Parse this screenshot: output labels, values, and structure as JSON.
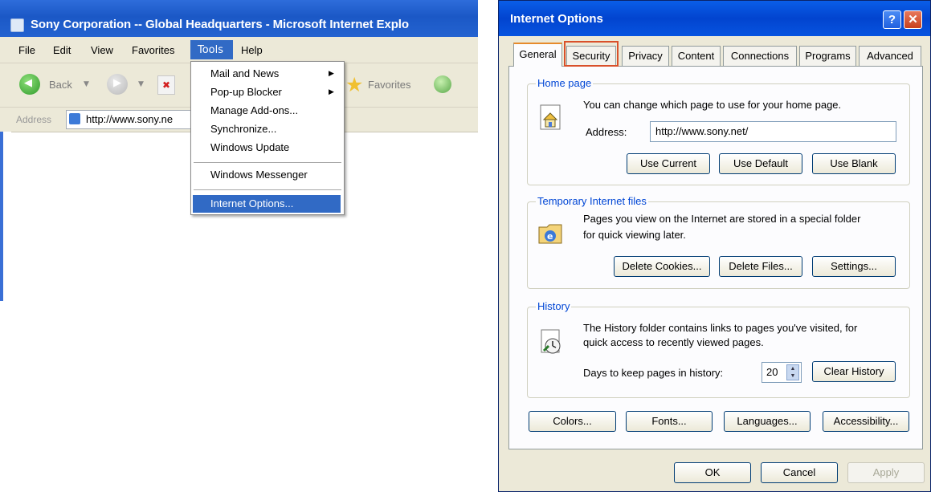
{
  "ie": {
    "title": "Sony Corporation -- Global Headquarters - Microsoft Internet Explo",
    "menu": [
      "File",
      "Edit",
      "View",
      "Favorites",
      "Tools",
      "Help"
    ],
    "toolbar": {
      "back": "Back",
      "favorites": "Favorites"
    },
    "address": {
      "label": "Address",
      "value": "http://www.sony.ne"
    },
    "tools_menu": {
      "items": [
        "Mail and News",
        "Pop-up Blocker",
        "Manage Add-ons...",
        "Synchronize...",
        "Windows Update",
        "Windows Messenger",
        "Internet Options..."
      ]
    }
  },
  "dialog": {
    "title": "Internet Options",
    "help_label": "?",
    "close_label": "✕",
    "tabs": [
      "General",
      "Security",
      "Privacy",
      "Content",
      "Connections",
      "Programs",
      "Advanced"
    ],
    "home_page": {
      "label": "Home page",
      "description": "You can change which page to use for your home page.",
      "address_label": "Address:",
      "address_value": "http://www.sony.net/",
      "buttons": [
        "Use Current",
        "Use Default",
        "Use Blank"
      ]
    },
    "temp_files": {
      "label": "Temporary Internet files",
      "description_1": "Pages you view on the Internet are stored in a special folder",
      "description_2": "for quick viewing later.",
      "buttons": [
        "Delete Cookies...",
        "Delete Files...",
        "Settings..."
      ]
    },
    "history": {
      "label": "History",
      "description_1": "The History folder contains links to pages you've visited, for",
      "description_2": "quick access to recently viewed pages.",
      "days_label": "Days to keep pages in history:",
      "days_value": "20",
      "clear_button": "Clear History"
    },
    "bottom_buttons": [
      "Colors...",
      "Fonts...",
      "Languages...",
      "Accessibility..."
    ],
    "footer_buttons": [
      "OK",
      "Cancel",
      "Apply"
    ]
  }
}
